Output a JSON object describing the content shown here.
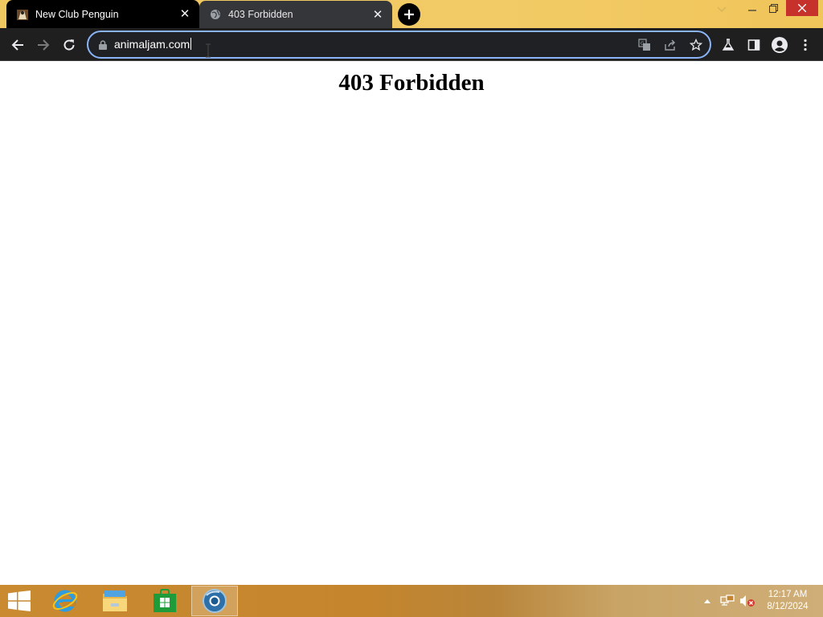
{
  "browser": {
    "tabs": [
      {
        "title": "New Club Penguin",
        "favicon": "club-penguin-favicon",
        "active": true
      },
      {
        "title": "403 Forbidden",
        "favicon": "globe-icon",
        "active": false
      }
    ],
    "address_bar": {
      "url": "animaljam.com"
    },
    "accent_color": "#8ab4f8"
  },
  "page": {
    "heading": "403 Forbidden"
  },
  "taskbar": {
    "apps": [
      "internet-explorer-icon",
      "file-explorer-icon",
      "store-icon",
      "chrome-icon"
    ],
    "clock": {
      "time": "12:17 AM",
      "date": "8/12/2024"
    }
  }
}
